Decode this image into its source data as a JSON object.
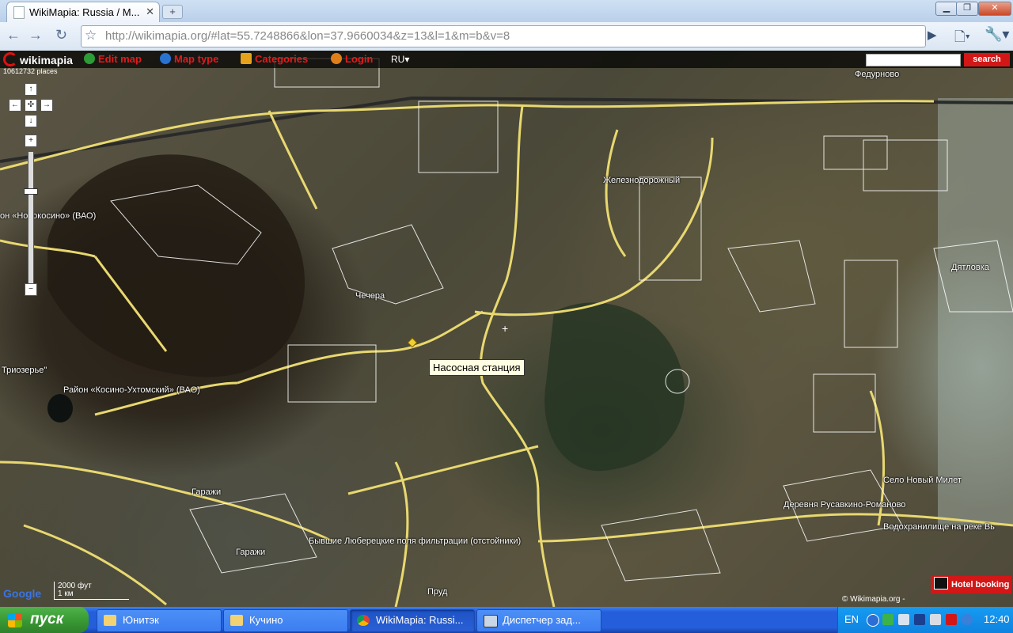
{
  "browser": {
    "tab_title": "WikiMapia: Russia / M...",
    "tab_close": "✕",
    "new_tab": "+",
    "window_buttons": {
      "minimize": "▁",
      "maximize": "❐",
      "close": "✕"
    },
    "url_host": "http://wikimapia.org",
    "url_rest": "/#lat=55.7248866&lon=37.9660034&z=13&l=1&m=b&v=8",
    "back": "←",
    "forward": "→",
    "reload": "↻",
    "star": "☆",
    "go": "▶",
    "page_menu": "🗋▾",
    "wrench": "🔧▾"
  },
  "wikimapia": {
    "logo": "wikimapia",
    "menu": [
      {
        "label": "Edit map",
        "icon": "globe-icon",
        "color": "#2d9b37"
      },
      {
        "label": "Map type",
        "icon": "compass-icon",
        "color": "#2a72cf"
      },
      {
        "label": "Categories",
        "icon": "categories-icon",
        "color": "#e7a21b"
      },
      {
        "label": "Login",
        "icon": "user-icon",
        "color": "#e07f1a"
      }
    ],
    "lang": "RU▾",
    "search_label": "search",
    "places_count": "10612732 places",
    "hotel_label": "Hotel booking",
    "copyright": "© Wikimapia.org -",
    "scale_top": "2000 фут",
    "scale_bottom": "1 км",
    "google_logo": "Google",
    "accent": "#d31717"
  },
  "map_labels": [
    "Федурново",
    "Железнодорожный",
    "он «Новокосино» (ВАО)",
    "Дятловка",
    "Чечера",
    "Триозерье\"",
    "Район «Косино-Ухтомский» (ВАО)",
    "Село Новый Милет",
    "Деревня Русавкино-Романово",
    "Водохранилище на реке Вь",
    "Гаражи",
    "Гаражи",
    "Бывшие Люберецкие поля фильтрации (отстойники)",
    "Пруд"
  ],
  "tooltip": "Насосная станция",
  "zoom": {
    "up": "↑",
    "left": "←",
    "center": "✣",
    "right": "→",
    "down": "↓",
    "in": "+",
    "out": "−"
  },
  "taskbar": {
    "start": "пуск",
    "tasks": [
      {
        "label": "Юнитэк",
        "icon": "folder-icon"
      },
      {
        "label": "Кучино",
        "icon": "folder-icon"
      },
      {
        "label": "WikiMapia: Russi...",
        "icon": "chrome-icon"
      },
      {
        "label": "Диспетчер зад...",
        "icon": "task-manager-icon"
      }
    ],
    "lang": "EN",
    "clock": "12:40"
  }
}
